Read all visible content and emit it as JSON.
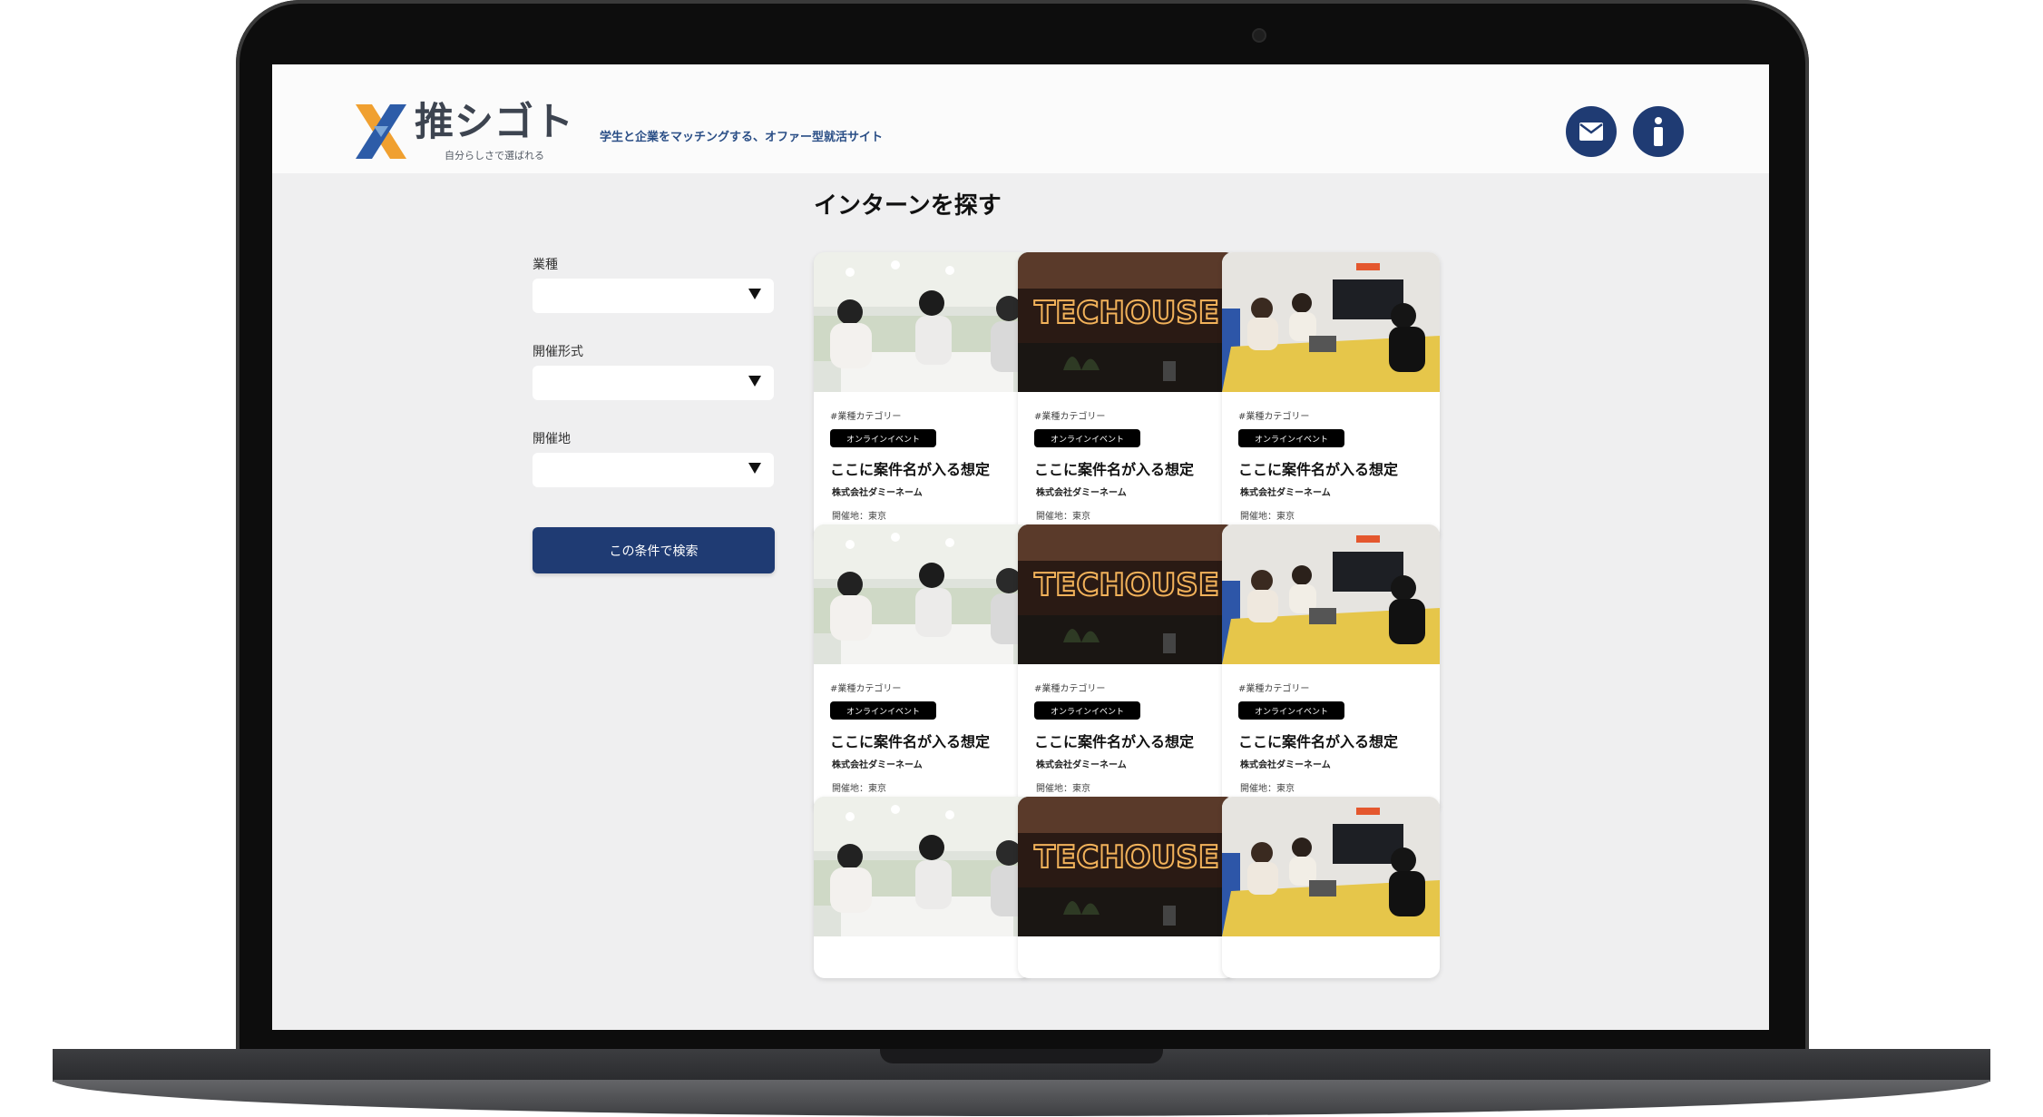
{
  "brand": {
    "logo_text": "推シゴト",
    "logo_sub": "自分らしさで選ばれる",
    "tagline": "学生と企業をマッチングする、オファー型就活サイト"
  },
  "header_icons": {
    "mail": "mail-icon",
    "info": "info-icon"
  },
  "colors": {
    "primary": "#1f3b73",
    "logo_orange": "#f0a030",
    "logo_blue": "#2d5ca8"
  },
  "page": {
    "title": "インターンを探す"
  },
  "filters": [
    {
      "label": "業種",
      "value": ""
    },
    {
      "label": "開催形式",
      "value": ""
    },
    {
      "label": "開催地",
      "value": ""
    }
  ],
  "search_button": "この条件で検索",
  "cards": [
    {
      "photo": "office-meeting-photo",
      "category": "#業種カテゴリー",
      "badge": "オンラインイベント",
      "title": "ここに案件名が入る想定",
      "company": "株式会社ダミーネーム",
      "location": "開催地：東京"
    },
    {
      "photo": "techouse-sign-photo",
      "category": "#業種カテゴリー",
      "badge": "オンラインイベント",
      "title": "ここに案件名が入る想定",
      "company": "株式会社ダミーネーム",
      "location": "開催地：東京"
    },
    {
      "photo": "conference-room-photo",
      "category": "#業種カテゴリー",
      "badge": "オンラインイベント",
      "title": "ここに案件名が入る想定",
      "company": "株式会社ダミーネーム",
      "location": "開催地：東京"
    },
    {
      "photo": "office-meeting-photo",
      "category": "#業種カテゴリー",
      "badge": "オンラインイベント",
      "title": "ここに案件名が入る想定",
      "company": "株式会社ダミーネーム",
      "location": "開催地：東京"
    },
    {
      "photo": "techouse-sign-photo",
      "category": "#業種カテゴリー",
      "badge": "オンラインイベント",
      "title": "ここに案件名が入る想定",
      "company": "株式会社ダミーネーム",
      "location": "開催地：東京"
    },
    {
      "photo": "conference-room-photo",
      "category": "#業種カテゴリー",
      "badge": "オンラインイベント",
      "title": "ここに案件名が入る想定",
      "company": "株式会社ダミーネーム",
      "location": "開催地：東京"
    },
    {
      "photo": "office-meeting-photo"
    },
    {
      "photo": "techouse-sign-photo"
    },
    {
      "photo": "conference-room-photo"
    }
  ],
  "neon_sign_text": "TECHOUSE"
}
